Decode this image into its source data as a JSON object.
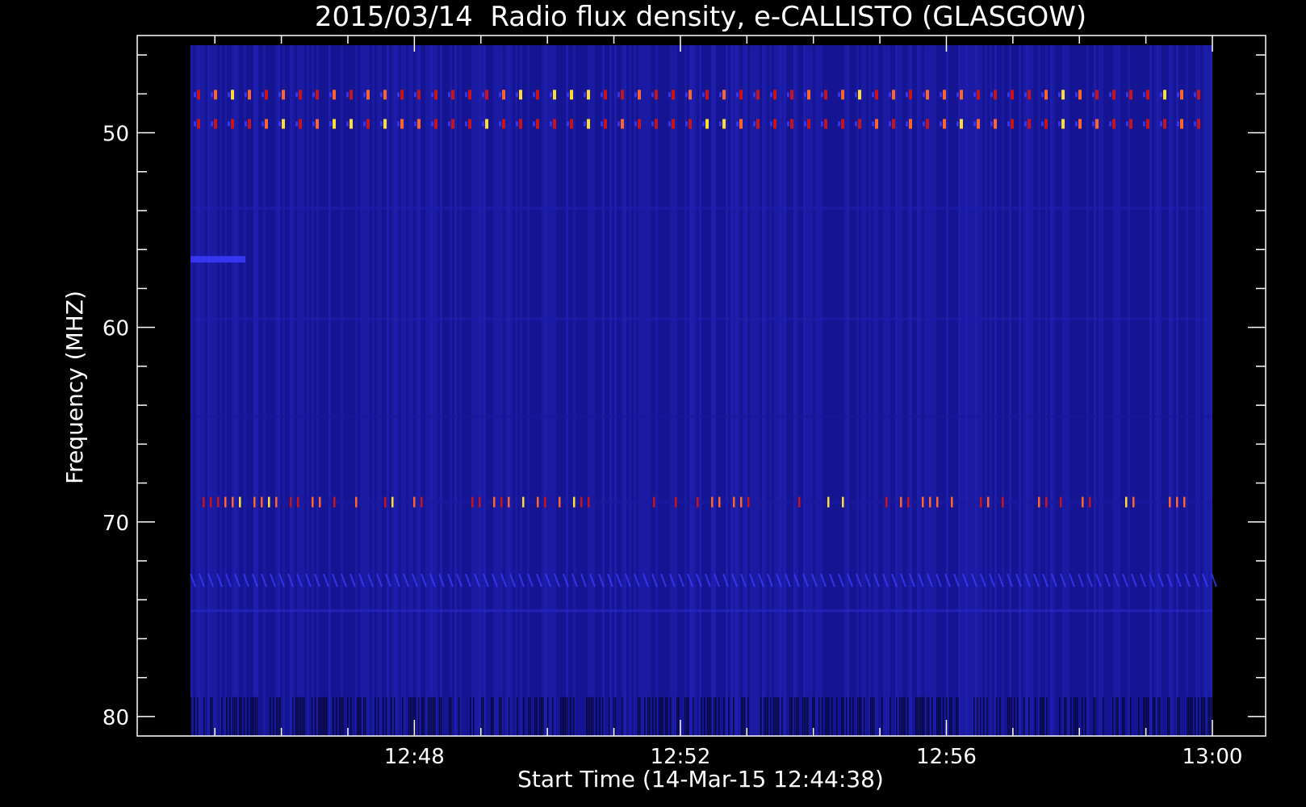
{
  "chart_data": {
    "type": "heatmap",
    "title": "2015/03/14  Radio flux density, e-CALLISTO (GLASGOW)",
    "xlabel": "Start Time (14-Mar-15 12:44:38)",
    "ylabel": "Frequency (MHZ)",
    "x_range_minutes": [
      "12:44:38",
      "13:00:00"
    ],
    "x_ticks": [
      {
        "value": "12:48",
        "minutes_after_12_44": 4
      },
      {
        "value": "12:52",
        "minutes_after_12_44": 8
      },
      {
        "value": "12:56",
        "minutes_after_12_44": 12
      },
      {
        "value": "13:00",
        "minutes_after_12_44": 16
      }
    ],
    "y_ticks": [
      50,
      60,
      70,
      80
    ],
    "ylim": [
      45,
      81
    ],
    "y_inverted": true,
    "data_extent": {
      "t_start": "12:44:38",
      "t_end": "13:00:00",
      "f_top": 45.5,
      "f_bottom": 81
    },
    "colormap": [
      "#000000",
      "#0a0a78",
      "#1a1aa0",
      "#3c3cff",
      "#c81414",
      "#ff6428",
      "#ffdc32"
    ],
    "background_color": "#1a1aa0",
    "features": [
      {
        "label": "interference band",
        "freq_mhz": 48.0,
        "intensity": "high",
        "pattern": "periodic pulses"
      },
      {
        "label": "interference band",
        "freq_mhz": 49.5,
        "intensity": "high",
        "pattern": "periodic pulses"
      },
      {
        "label": "interference band",
        "freq_mhz": 69.0,
        "intensity": "medium",
        "pattern": "sporadic pulses"
      },
      {
        "label": "faint band",
        "freq_mhz": 56.5,
        "intensity": "low",
        "time_end": "12:45:30"
      },
      {
        "label": "chirp band",
        "freq_mhz": 73.0,
        "intensity": "low",
        "pattern": "diagonal streaks"
      }
    ]
  }
}
